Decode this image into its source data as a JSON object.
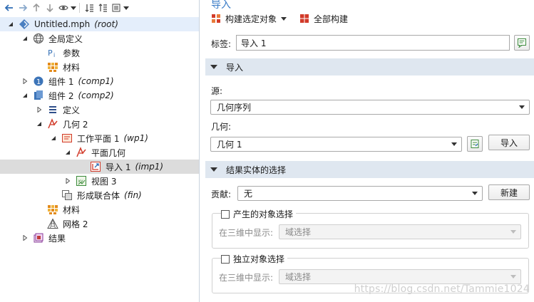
{
  "left_toolbar": {
    "icons": [
      "back-arrow-icon",
      "forward-arrow-icon",
      "up-arrow-icon",
      "down-arrow-icon",
      "eye-icon",
      "dropdown-icon",
      "collapse-icon",
      "expand-icon",
      "list-icon",
      "dropdown-icon"
    ]
  },
  "tree": {
    "root": {
      "label": "Untitled.mph",
      "tag": "(root)"
    },
    "global": {
      "label": "全局定义"
    },
    "params": {
      "label": "参数"
    },
    "materials_global": {
      "label": "材料"
    },
    "comp1": {
      "label": "组件 1",
      "tag": "(comp1)"
    },
    "comp2": {
      "label": "组件 2",
      "tag": "(comp2)"
    },
    "definitions": {
      "label": "定义"
    },
    "geom2": {
      "label": "几何 2"
    },
    "wp1": {
      "label": "工作平面 1",
      "tag": "(wp1)"
    },
    "plane_geom": {
      "label": "平面几何"
    },
    "imp1": {
      "label": "导入 1",
      "tag": "(imp1)"
    },
    "view3": {
      "label": "视图 3"
    },
    "fin": {
      "label": "形成联合体",
      "tag": "(fin)"
    },
    "materials": {
      "label": "材料"
    },
    "mesh2": {
      "label": "网格 2"
    },
    "results": {
      "label": "结果"
    }
  },
  "settings": {
    "title": "导入",
    "build_selected": "构建选定对象",
    "build_all": "全部构建",
    "label_caption": "标签:",
    "label_value": "导入 1",
    "section_import": "导入",
    "source_caption": "源:",
    "source_value": "几何序列",
    "geometry_caption": "几何:",
    "geometry_value": "几何 1",
    "import_button": "导入",
    "section_selection": "结果实体的选择",
    "contribute_caption": "贡献:",
    "contribute_value": "无",
    "new_button": "新建",
    "check1_label": "产生的对象选择",
    "show3d_caption_1": "在三维中显示:",
    "show3d_value_1": "域选择",
    "check2_label": "独立对象选择",
    "show3d_caption_2": "在三维中显示:",
    "show3d_value_2": "域选择"
  },
  "watermark": "https://blog.csdn.net/Tammie1024",
  "colors": {
    "accent": "#3a7cc7",
    "section_bg": "#dfe7f0",
    "selected_row": "#dcdcdc",
    "root_row": "#e4eefb"
  }
}
